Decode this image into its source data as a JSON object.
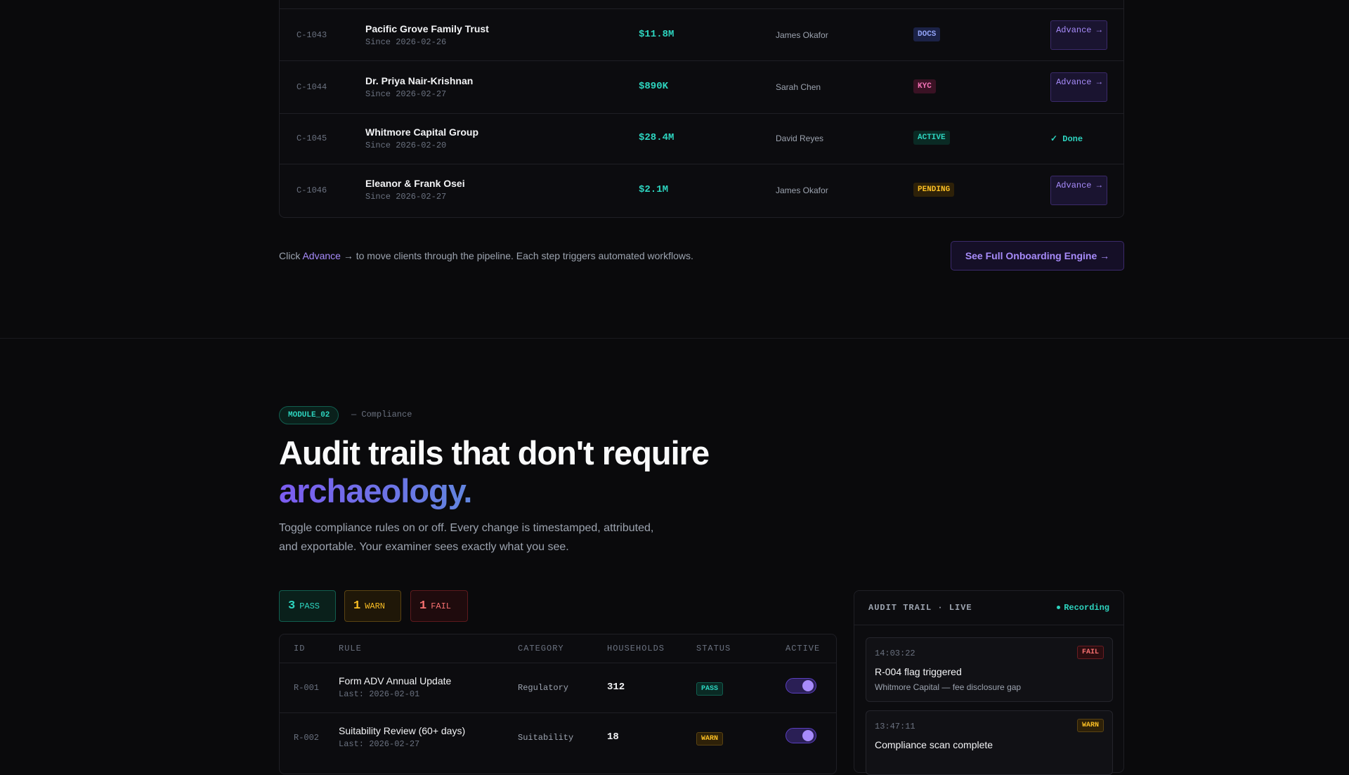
{
  "pipeline": {
    "rows": [
      {
        "id": "C-1043",
        "name": "Pacific Grove Family Trust",
        "since": "Since 2026-02-26",
        "aum": "$11.8M",
        "advisor": "James Okafor",
        "stage": "DOCS",
        "action": "Advance →"
      },
      {
        "id": "C-1044",
        "name": "Dr. Priya Nair-Krishnan",
        "since": "Since 2026-02-27",
        "aum": "$890K",
        "advisor": "Sarah Chen",
        "stage": "KYC",
        "action": "Advance →"
      },
      {
        "id": "C-1045",
        "name": "Whitmore Capital Group",
        "since": "Since 2026-02-20",
        "aum": "$28.4M",
        "advisor": "David Reyes",
        "stage": "ACTIVE",
        "action": "✓ Done"
      },
      {
        "id": "C-1046",
        "name": "Eleanor & Frank Osei",
        "since": "Since 2026-02-27",
        "aum": "$2.1M",
        "advisor": "James Okafor",
        "stage": "PENDING",
        "action": "Advance →"
      }
    ],
    "hint_prefix": "Click",
    "hint_accent": "Advance",
    "hint_suffix": "→ to move clients through the pipeline. Each step triggers automated workflows.",
    "engine_button": "See Full Onboarding Engine →"
  },
  "module": {
    "tag": "MODULE_02",
    "subtitle": "— Compliance",
    "headline_line1": "Audit trails that don't require",
    "headline_line2": "archaeology.",
    "description": "Toggle compliance rules on or off. Every change is timestamped, attributed, and exportable. Your examiner sees exactly what you see."
  },
  "counters": {
    "pass": {
      "count": "3",
      "label": "PASS"
    },
    "warn": {
      "count": "1",
      "label": "WARN"
    },
    "fail": {
      "count": "1",
      "label": "FAIL"
    }
  },
  "rules": {
    "headers": {
      "id": "ID",
      "rule": "RULE",
      "category": "CATEGORY",
      "households": "HOUSEHOLDS",
      "status": "STATUS",
      "active": "ACTIVE"
    },
    "rows": [
      {
        "id": "R-001",
        "name": "Form ADV Annual Update",
        "last": "Last: 2026-02-01",
        "category": "Regulatory",
        "households": "312",
        "status": "PASS",
        "active": true
      },
      {
        "id": "R-002",
        "name": "Suitability Review (60+ days)",
        "last": "Last: 2026-02-27",
        "category": "Suitability",
        "households": "18",
        "status": "WARN",
        "active": true
      }
    ]
  },
  "audit": {
    "title": "AUDIT TRAIL · LIVE",
    "recording": "Recording",
    "events": [
      {
        "time": "14:03:22",
        "tag": "FAIL",
        "title": "R-004 flag triggered",
        "detail": "Whitmore Capital — fee disclosure gap"
      },
      {
        "time": "13:47:11",
        "tag": "WARN",
        "title": "Compliance scan complete",
        "detail": ""
      }
    ]
  }
}
